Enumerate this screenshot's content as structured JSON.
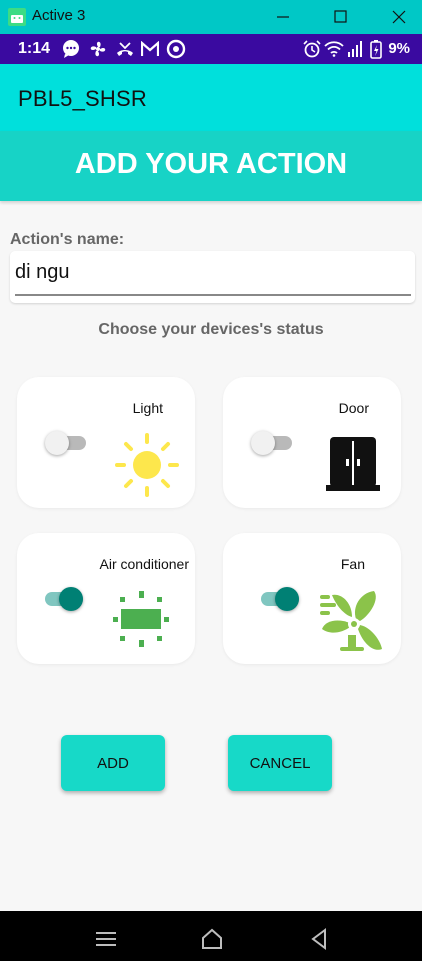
{
  "window": {
    "title": "Active 3"
  },
  "status_bar": {
    "time": "1:14",
    "battery": "9%",
    "notification_icons": [
      "chat-icon",
      "fan-icon",
      "missed-call-icon",
      "gmail-icon",
      "sync-icon"
    ],
    "system_icons": [
      "alarm-icon",
      "wifi-icon",
      "signal-icon",
      "battery-icon"
    ]
  },
  "app_bar": {
    "title": "PBL5_SHSR"
  },
  "header": {
    "title": "ADD YOUR ACTION"
  },
  "form": {
    "name_label": "Action's name:",
    "name_value": "di ngu",
    "choose_label": "Choose your devices's status"
  },
  "devices": [
    {
      "label": "Light",
      "on": false,
      "icon": "sun-icon"
    },
    {
      "label": "Door",
      "on": false,
      "icon": "door-icon"
    },
    {
      "label": "Air conditioner",
      "on": true,
      "icon": "air-conditioner-icon"
    },
    {
      "label": "Fan",
      "on": true,
      "icon": "fan-icon"
    }
  ],
  "buttons": {
    "add": "ADD",
    "cancel": "CANCEL"
  },
  "colors": {
    "accent": "#17d9c8",
    "toggle_on": "#008074",
    "toggle_on_track": "#80c6c0",
    "toggle_off": "#f1f1f1",
    "toggle_off_track": "#b9b9b9",
    "sun": "#fde74c",
    "device_green": "#4caf50",
    "fan_green": "#8bc34a"
  }
}
